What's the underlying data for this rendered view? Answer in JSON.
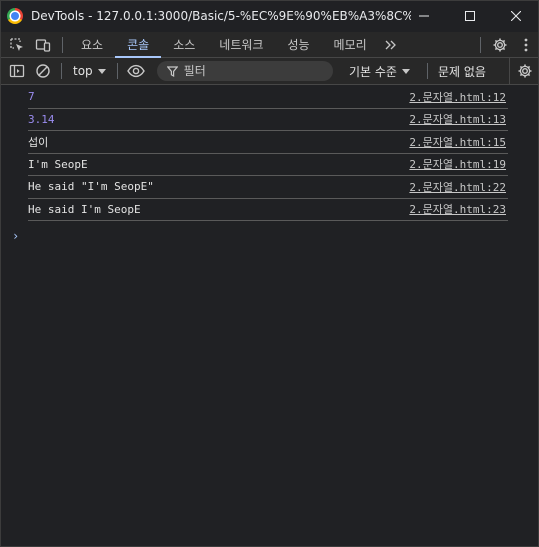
{
  "window": {
    "title": "DevTools - 127.0.0.1:3000/Basic/5-%EC%9E%90%EB%A3%8C%ED%98%95/2.%EB%AC%B8%EC%9E%90%EC%97%B4.html"
  },
  "tabs": [
    {
      "label": "요소",
      "active": false
    },
    {
      "label": "콘솔",
      "active": true
    },
    {
      "label": "소스",
      "active": false
    },
    {
      "label": "네트워크",
      "active": false
    },
    {
      "label": "성능",
      "active": false
    },
    {
      "label": "메모리",
      "active": false
    }
  ],
  "toolbar": {
    "context": "top",
    "filter_placeholder": "필터",
    "levels_label": "기본 수준",
    "issues_label": "문제 없음"
  },
  "console": {
    "rows": [
      {
        "text": "7",
        "type": "number",
        "source": "2.문자열.html:12"
      },
      {
        "text": "3.14",
        "type": "number",
        "source": "2.문자열.html:13"
      },
      {
        "text": "섭이",
        "type": "string",
        "source": "2.문자열.html:15"
      },
      {
        "text": "I'm SeopE",
        "type": "string",
        "source": "2.문자열.html:19"
      },
      {
        "text": "He said \"I'm SeopE\"",
        "type": "string",
        "source": "2.문자열.html:22"
      },
      {
        "text": "He said I'm SeopE",
        "type": "string",
        "source": "2.문자열.html:23"
      }
    ],
    "prompt": "›"
  },
  "colors": {
    "accent": "#a8c7fa",
    "number": "#9a8cf0",
    "background": "#202124"
  }
}
